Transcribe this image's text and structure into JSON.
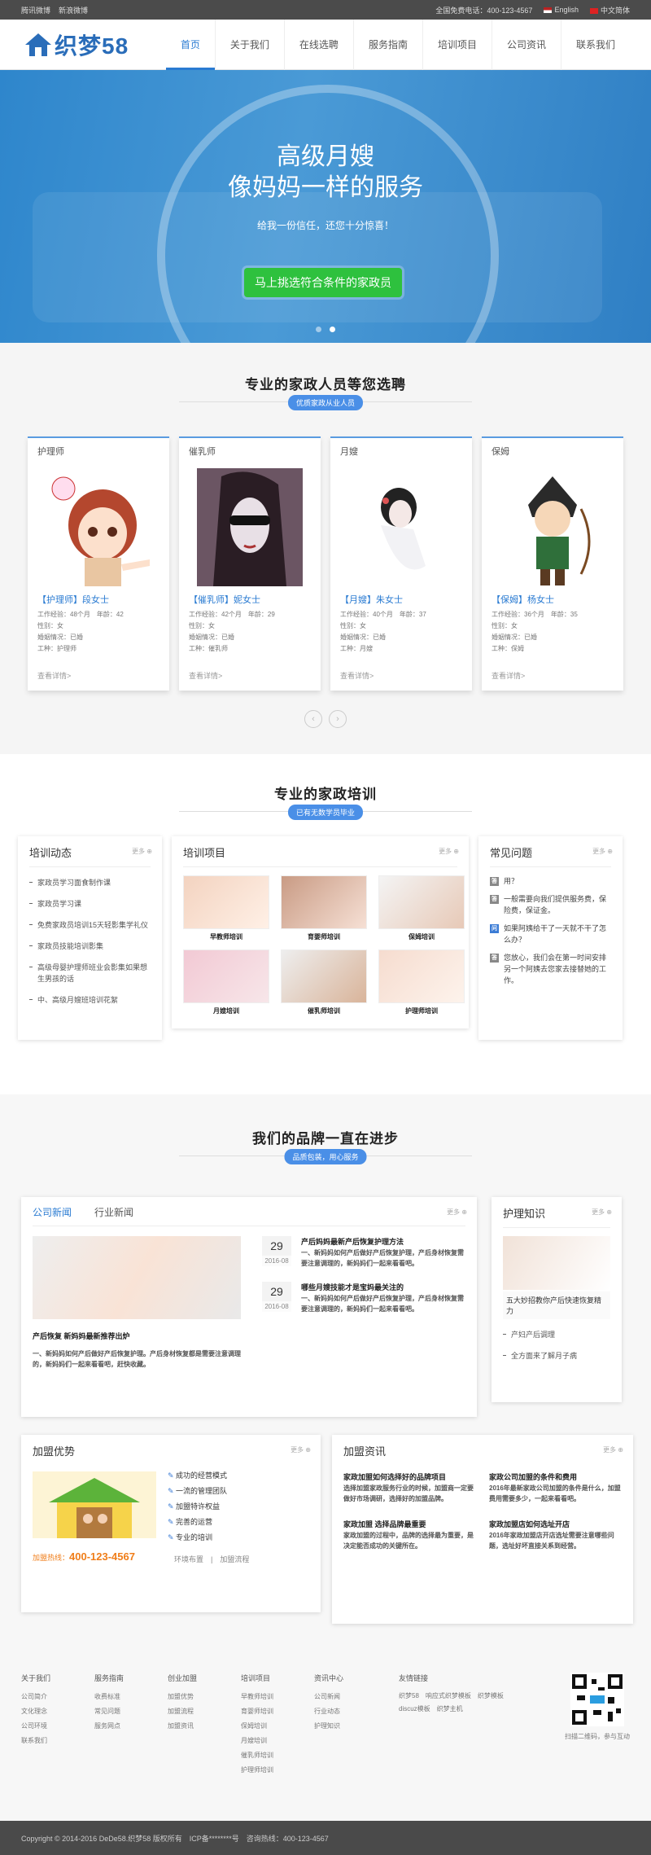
{
  "topbar": {
    "links": [
      "腾讯微博",
      "新浪微博"
    ],
    "phone": "全国免费电话：400-123-4567",
    "lang_en": "English",
    "lang_cn": "中文简体"
  },
  "header": {
    "logo": "织梦58",
    "nav": [
      "首页",
      "关于我们",
      "在线选聘",
      "服务指南",
      "培训项目",
      "公司资讯",
      "联系我们"
    ]
  },
  "banner": {
    "line1": "高级月嫂",
    "line2": "像妈妈一样的服务",
    "sub": "给我一份信任，还您十分惊喜！",
    "cta": "马上挑选符合条件的家政员"
  },
  "s1": {
    "title": "专业的家政人员等您选聘",
    "badge": "优质家政从业人员",
    "cards": [
      {
        "cat": "护理师",
        "name": "【护理师】段女士",
        "m1": "工作经验：48个月　年龄：42",
        "m2": "性别：女",
        "m3": "婚姻情况：已婚",
        "m4": "工种：护理师",
        "more": "查看详情>"
      },
      {
        "cat": "催乳师",
        "name": "【催乳师】妮女士",
        "m1": "工作经验：42个月　年龄：29",
        "m2": "性别：女",
        "m3": "婚姻情况：已婚",
        "m4": "工种：催乳师",
        "more": "查看详情>"
      },
      {
        "cat": "月嫂",
        "name": "【月嫂】朱女士",
        "m1": "工作经验：40个月　年龄：37",
        "m2": "性别：女",
        "m3": "婚姻情况：已婚",
        "m4": "工种：月嫂",
        "more": "查看详情>"
      },
      {
        "cat": "保姆",
        "name": "【保姆】杨女士",
        "m1": "工作经验：36个月　年龄：35",
        "m2": "性别：女",
        "m3": "婚姻情况：已婚",
        "m4": "工种：保姆",
        "more": "查看详情>"
      }
    ],
    "prev": "‹",
    "next": "›"
  },
  "s2": {
    "title": "专业的家政培训",
    "badge": "已有无数学员毕业",
    "more": "更多",
    "trend": {
      "title": "培训动态",
      "items": [
        "家政员学习面食制作课",
        "家政员学习课",
        "免费家政员培训15天轻影集学礼仪",
        "家政员技能培训影集",
        "高级母婴护理师班业会影集如果想生男孩的话",
        "中、高级月嫂班培训花絮"
      ]
    },
    "proj": {
      "title": "培训项目",
      "items": [
        "早教师培训",
        "育婴师培训",
        "保姆培训",
        "月嫂培训",
        "催乳师培训",
        "护理师培训"
      ]
    },
    "faq": {
      "title": "常见问题",
      "items": [
        {
          "k": "答",
          "t": "用？"
        },
        {
          "k": "答",
          "t": "一般需要向我们提供服务费，保险费，保证金。"
        },
        {
          "k": "问",
          "t": "如果阿姨给干了一天就不干了怎么办？"
        },
        {
          "k": "答",
          "t": "您放心，我们会在第一时间安排另一个阿姨去您家去接替她的工作。"
        }
      ]
    }
  },
  "s3": {
    "title": "我们的品牌一直在进步",
    "badge": "品质包装，用心服务",
    "more": "更多",
    "tabs": [
      "公司新闻",
      "行业新闻"
    ],
    "feature": {
      "title": "产后恢复 新妈妈最新推荐出炉",
      "desc": "一、新妈妈如何产后做好产后恢复护理。产后身材恢复都是需要注意调理的，新妈妈们一起来看看吧，赶快收藏。"
    },
    "news": [
      {
        "day": "29",
        "ym": "2016-08",
        "title": "产后妈妈最新产后恢复护理方法",
        "desc": "一、新妈妈如何产后做好产后恢复护理，产后身材恢复需要注意调理的，新妈妈们一起来看看吧。"
      },
      {
        "day": "29",
        "ym": "2016-08",
        "title": "哪些月嫂技能才是宝妈最关注的",
        "desc": "一、新妈妈如何产后做好产后恢复护理，产后身材恢复需要注意调理的，新妈妈们一起来看看吧。"
      }
    ],
    "care": {
      "title": "护理知识",
      "feat": "五大妙招教你产后快速恢复精力",
      "items": [
        "产妇产后调理",
        "全方面来了解月子病"
      ]
    },
    "join": {
      "title": "加盟优势",
      "hotline_label": "加盟热线：",
      "hotline": "400-123-4567",
      "items": [
        "成功的经营模式",
        "一流的管理团队",
        "加盟特许权益",
        "完善的运营",
        "专业的培训"
      ],
      "links": [
        "环境布置",
        "加盟流程"
      ]
    },
    "joinnews": {
      "title": "加盟资讯",
      "items": [
        {
          "t": "家政加盟如何选择好的品牌项目",
          "d": "选择加盟家政服务行业的时候，加盟商一定要做好市场调研，选择好的加盟品牌。"
        },
        {
          "t": "家政公司加盟的条件和费用",
          "d": "2016年最新家政公司加盟的条件是什么，加盟费用需要多少，一起来看看吧。"
        },
        {
          "t": "家政加盟 选择品牌最重要",
          "d": "家政加盟的过程中，品牌的选择最为重要，是决定能否成功的关键所在。"
        },
        {
          "t": "家政加盟店如何选址开店",
          "d": "2016年家政加盟店开店选址需要注意哪些问题，选址好坏直接关系到经营。"
        }
      ]
    }
  },
  "footer": {
    "cols": [
      {
        "h": "关于我们",
        "items": [
          "公司简介",
          "文化理念",
          "公司环境",
          "联系我们"
        ]
      },
      {
        "h": "服务指南",
        "items": [
          "收费标准",
          "常见问题",
          "服务网点"
        ]
      },
      {
        "h": "创业加盟",
        "items": [
          "加盟优势",
          "加盟流程",
          "加盟资讯"
        ]
      },
      {
        "h": "培训项目",
        "items": [
          "早教师培训",
          "育婴师培训",
          "保姆培训",
          "月嫂培训",
          "催乳师培训",
          "护理师培训"
        ]
      },
      {
        "h": "资讯中心",
        "items": [
          "公司新闻",
          "行业动态",
          "护理知识"
        ]
      }
    ],
    "friends_title": "友情链接",
    "friends": "织梦58　响应式织梦模板　织梦模板　discuz模板　织梦主机",
    "qr_caption": "扫描二维码，参与互动"
  },
  "copyright": "Copyright © 2014-2016 DeDe58.织梦58 版权所有　ICP备********号　咨询热线：400-123-4567",
  "colors": {
    "accent": "#2a7bd2",
    "cta": "#2ec13e",
    "topbar": "#4b4b4b"
  }
}
